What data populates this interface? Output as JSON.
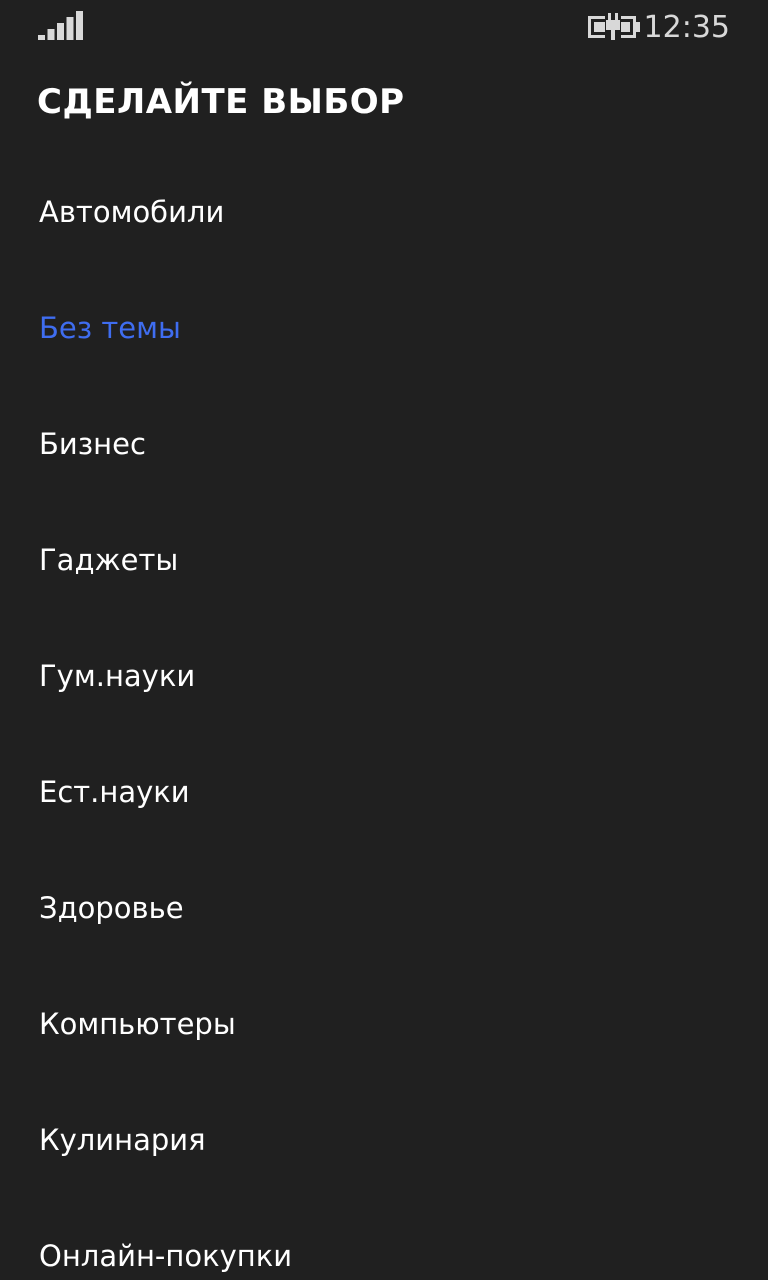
{
  "status_bar": {
    "signal_icon": "signal-strength-icon",
    "battery_icon": "battery-charging-icon",
    "time": "12:35"
  },
  "title": "СДЕЛАЙТЕ ВЫБОР",
  "accent_color": "#3f6df0",
  "items": [
    {
      "label": "Автомобили",
      "selected": false
    },
    {
      "label": "Без темы",
      "selected": true
    },
    {
      "label": "Бизнес",
      "selected": false
    },
    {
      "label": "Гаджеты",
      "selected": false
    },
    {
      "label": "Гум.науки",
      "selected": false
    },
    {
      "label": "Ест.науки",
      "selected": false
    },
    {
      "label": "Здоровье",
      "selected": false
    },
    {
      "label": "Компьютеры",
      "selected": false
    },
    {
      "label": "Кулинария",
      "selected": false
    },
    {
      "label": "Онлайн-покупки",
      "selected": false
    }
  ]
}
